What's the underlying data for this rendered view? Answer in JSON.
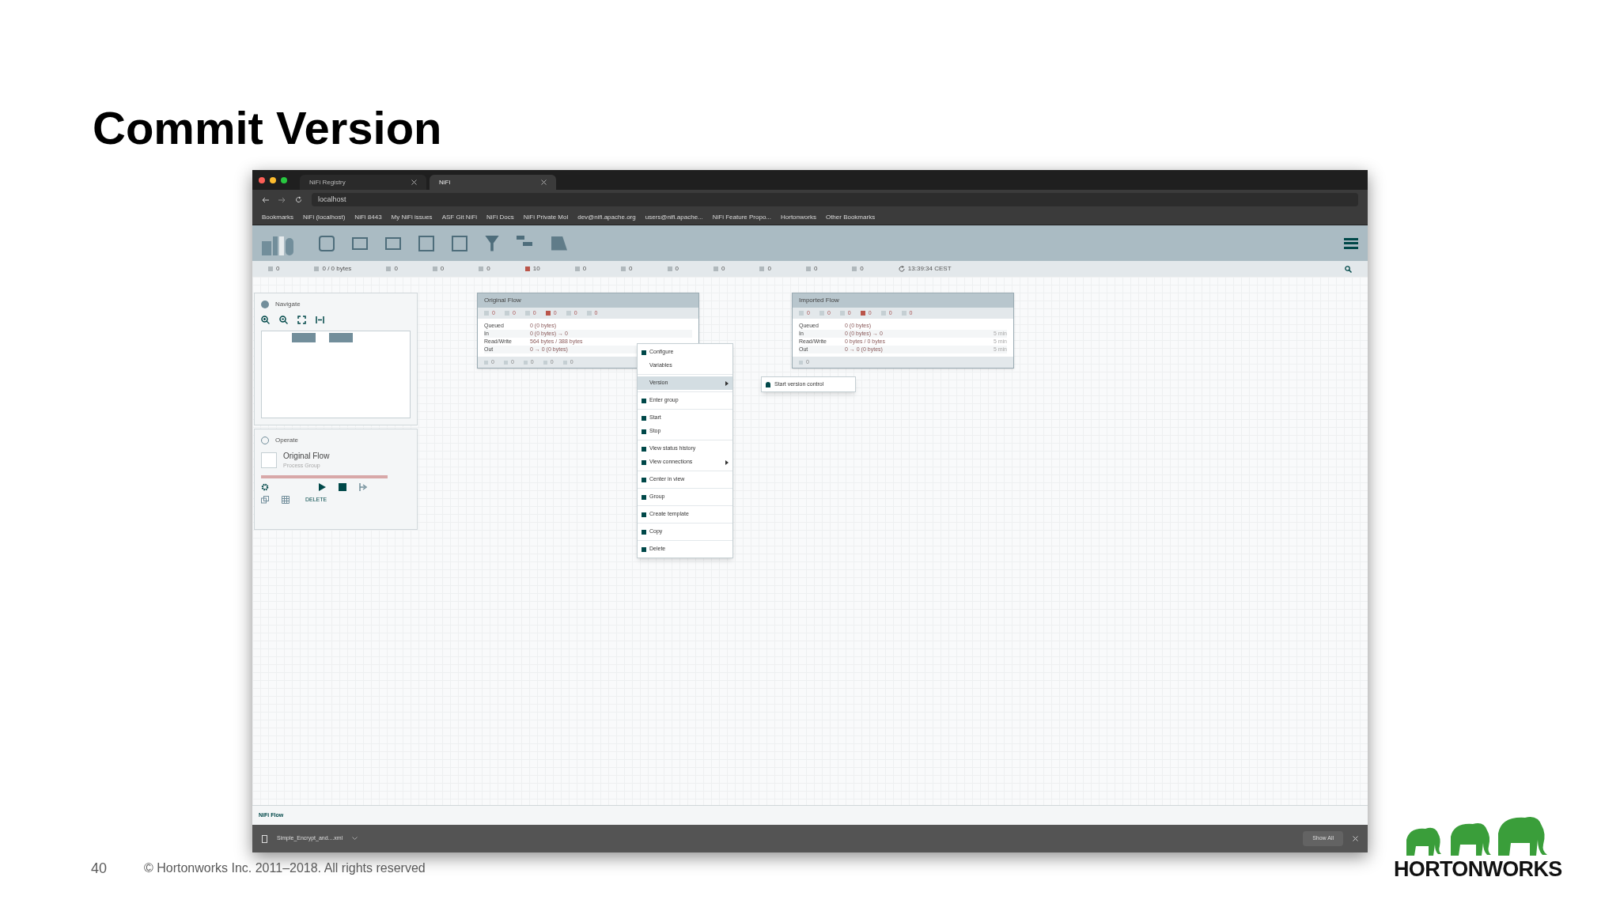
{
  "slide": {
    "title": "Commit Version",
    "page_number": "40",
    "copyright": "© Hortonworks Inc. 2011–2018. All rights reserved",
    "logo_text": "HORTONWORKS"
  },
  "browser": {
    "tabs": [
      {
        "label": "NiFi Registry",
        "selected": false
      },
      {
        "label": "NiFi",
        "selected": true
      }
    ],
    "address": "localhost",
    "bookmarks": [
      "Bookmarks",
      "NiFi (localhost)",
      "NiFi 8443",
      "My NiFi issues",
      "ASF Git NiFi",
      "NiFi Docs",
      "NiFi Private Mol",
      "dev@nifi.apache.org",
      "users@nifi.apache...",
      "NiFi Feature Propo...",
      "Hortonworks",
      "Other Bookmarks"
    ]
  },
  "nifi": {
    "status": [
      "0",
      "0 / 0 bytes",
      "0",
      "0",
      "0",
      "10",
      "0",
      "0",
      "0",
      "0",
      "0",
      "0",
      "0"
    ],
    "time": "13:39:34 CEST",
    "navigate": {
      "title": "Navigate"
    },
    "operate": {
      "title": "Operate",
      "name": "Original Flow",
      "type": "Process Group",
      "delete_label": "DELETE"
    },
    "groups": [
      {
        "title": "Original Flow",
        "counts": [
          "0",
          "0",
          "0",
          "0",
          "0",
          "0"
        ],
        "rows": [
          {
            "label": "Queued",
            "value": "0 (0 bytes)"
          },
          {
            "label": "In",
            "value": "0 (0 bytes) → 0"
          },
          {
            "label": "Read/Write",
            "value": "564 bytes / 388 bytes"
          },
          {
            "label": "Out",
            "value": "0 → 0 (0 bytes)"
          }
        ],
        "footer_counts": [
          "0",
          "0",
          "0",
          "0",
          "0"
        ]
      },
      {
        "title": "Imported Flow",
        "counts": [
          "0",
          "0",
          "0",
          "0",
          "0",
          "0"
        ],
        "rows": [
          {
            "label": "Queued",
            "value": "0 (0 bytes)",
            "time": ""
          },
          {
            "label": "In",
            "value": "0 (0 bytes) → 0",
            "time": "5 min"
          },
          {
            "label": "Read/Write",
            "value": "0 bytes / 0 bytes",
            "time": "5 min"
          },
          {
            "label": "Out",
            "value": "0 → 0 (0 bytes)",
            "time": "5 min"
          }
        ],
        "footer_counts": [
          "0"
        ]
      }
    ],
    "context_menu": [
      [
        {
          "label": "Configure",
          "has_icon": true,
          "submenu": false,
          "selected": false
        },
        {
          "label": "Variables",
          "has_icon": false,
          "submenu": false,
          "selected": false
        }
      ],
      [
        {
          "label": "Version",
          "has_icon": false,
          "submenu": true,
          "selected": true
        }
      ],
      [
        {
          "label": "Enter group",
          "has_icon": true,
          "submenu": false,
          "selected": false
        }
      ],
      [
        {
          "label": "Start",
          "has_icon": true,
          "submenu": false,
          "selected": false
        },
        {
          "label": "Stop",
          "has_icon": true,
          "submenu": false,
          "selected": false
        }
      ],
      [
        {
          "label": "View status history",
          "has_icon": true,
          "submenu": false,
          "selected": false
        },
        {
          "label": "View connections",
          "has_icon": true,
          "submenu": true,
          "selected": false
        }
      ],
      [
        {
          "label": "Center in view",
          "has_icon": true,
          "submenu": false,
          "selected": false
        }
      ],
      [
        {
          "label": "Group",
          "has_icon": true,
          "submenu": false,
          "selected": false
        }
      ],
      [
        {
          "label": "Create template",
          "has_icon": true,
          "submenu": false,
          "selected": false
        }
      ],
      [
        {
          "label": "Copy",
          "has_icon": true,
          "submenu": false,
          "selected": false
        }
      ],
      [
        {
          "label": "Delete",
          "has_icon": true,
          "submenu": false,
          "selected": false
        }
      ]
    ],
    "submenu": [
      {
        "label": "Start version control"
      }
    ],
    "breadcrumb": "NiFi Flow",
    "download": "Simple_Encrypt_and....xml",
    "show_all": "Show All"
  }
}
